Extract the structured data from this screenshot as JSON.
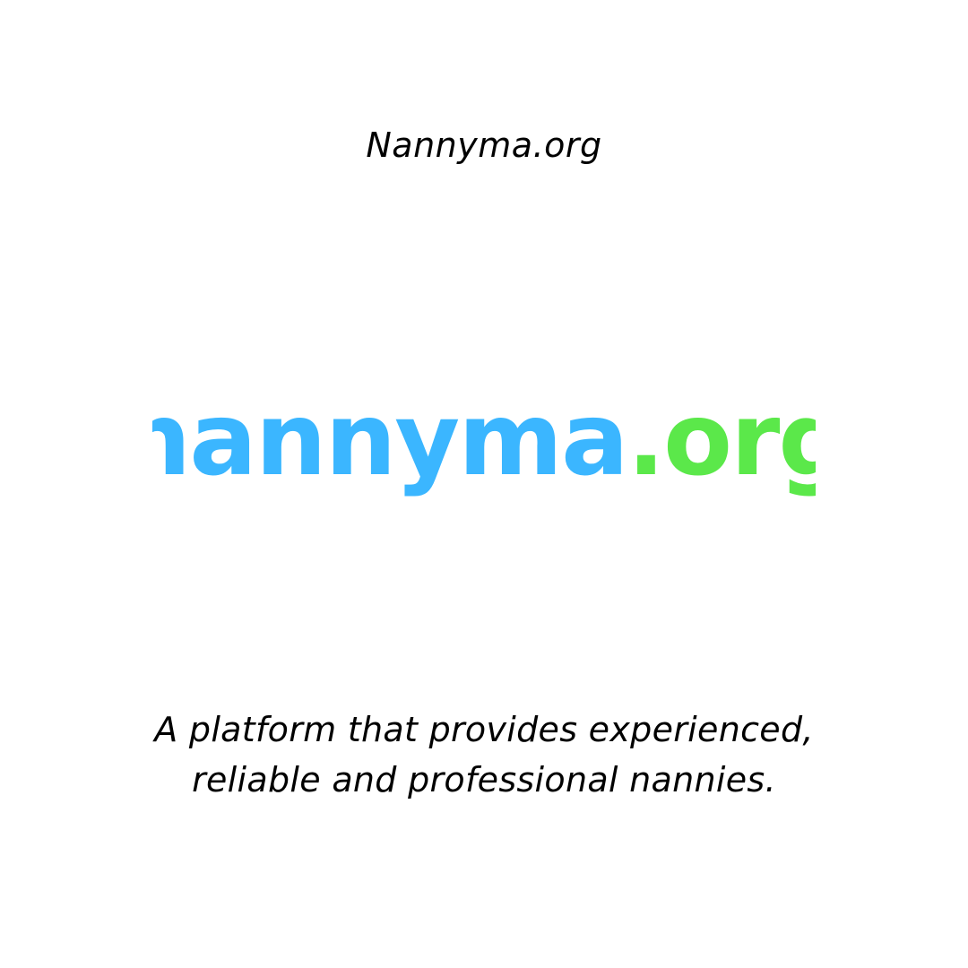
{
  "header": {
    "site_title": "Nannyma.org"
  },
  "logo": {
    "word_primary": "nannyma",
    "word_secondary": ".org",
    "color_primary": "#3BB6FF",
    "color_secondary": "#5BE84A"
  },
  "tagline": {
    "line1": "A platform that provides experienced,",
    "line2": "reliable and professional nannies."
  }
}
